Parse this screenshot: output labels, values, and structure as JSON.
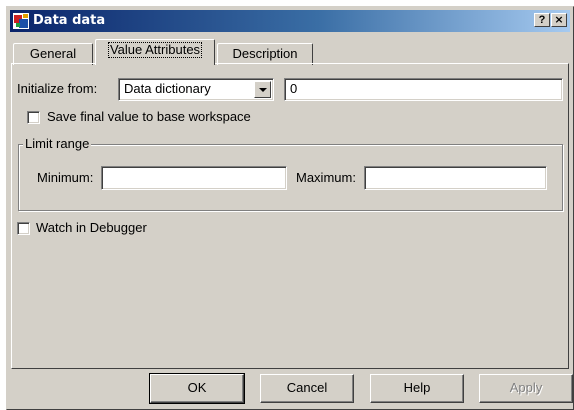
{
  "window": {
    "title": "Data data",
    "help_button": "?",
    "close_button": "×"
  },
  "tabs": [
    {
      "label": "General",
      "active": false
    },
    {
      "label": "Value Attributes",
      "active": true
    },
    {
      "label": "Description",
      "active": false
    }
  ],
  "value_attributes": {
    "initialize_from_label": "Initialize from:",
    "initialize_from_value": "Data dictionary",
    "initial_value": "0",
    "save_final_label": "Save final value to base workspace",
    "save_final_checked": false,
    "limit_range": {
      "group_label": "Limit range",
      "minimum_label": "Minimum:",
      "minimum_value": "",
      "maximum_label": "Maximum:",
      "maximum_value": ""
    },
    "watch_label": "Watch in Debugger",
    "watch_checked": false
  },
  "buttons": {
    "ok": "OK",
    "cancel": "Cancel",
    "help": "Help",
    "apply": "Apply",
    "apply_enabled": false
  }
}
